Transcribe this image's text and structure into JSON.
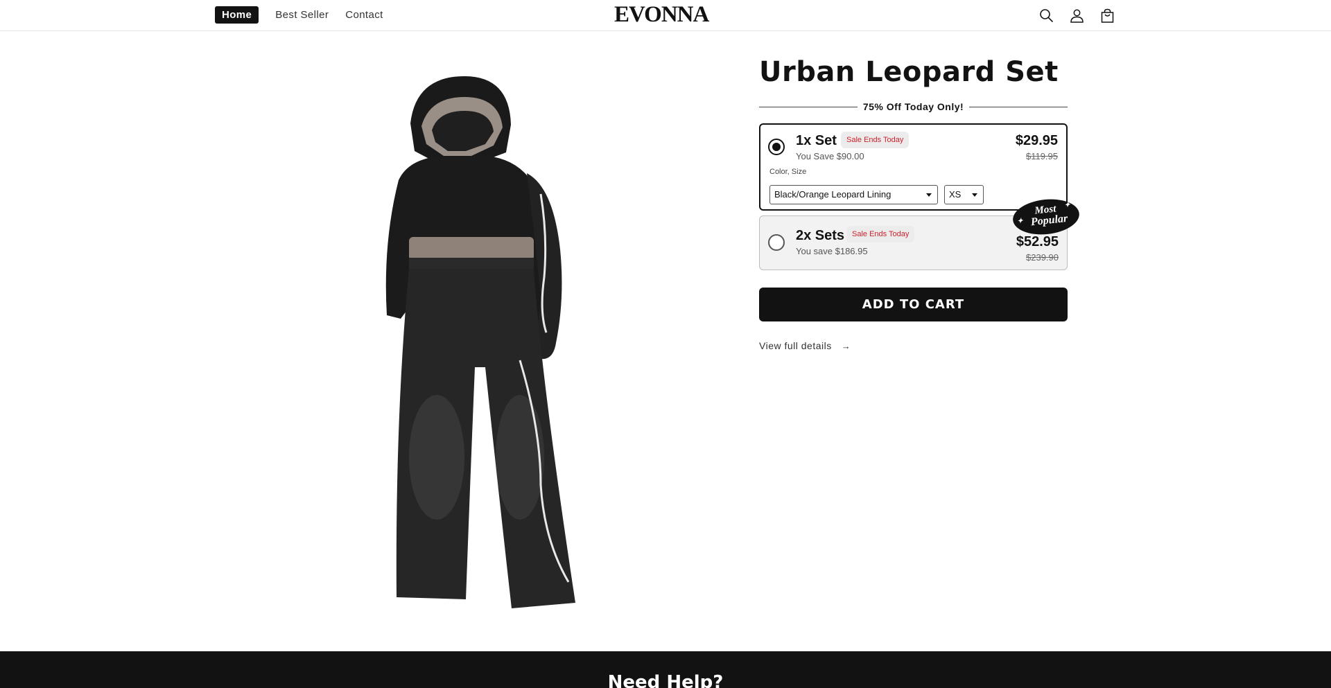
{
  "header": {
    "nav": [
      "Home",
      "Best Seller",
      "Contact"
    ],
    "logo": "EVONNA",
    "icons": [
      "search-icon",
      "account-icon",
      "cart-icon"
    ]
  },
  "product": {
    "title": "Urban Leopard Set",
    "promo": "75% Off Today Only!",
    "image": "hoodie-and-sweatpants-set-photo",
    "options": [
      {
        "name": "1x Set",
        "badge": "Sale Ends Today",
        "savings": "You Save $90.00",
        "price": "$29.95",
        "compare_price": "$119.95",
        "selected": true,
        "variant_label": "Color, Size",
        "color_value": "Black/Orange Leopard Lining",
        "size_value": "XS"
      },
      {
        "name": "2x Sets",
        "badge": "Sale Ends Today",
        "savings": "You save $186.95",
        "price": "$52.95",
        "compare_price": "$239.90",
        "selected": false
      }
    ],
    "popular_badge": {
      "line1": "Most",
      "line2": "Popular"
    },
    "add_to_cart": "ADD TO CART",
    "details_link": "View full details"
  },
  "footer": {
    "title": "Need Help?"
  },
  "colors": {
    "primary": "#121212",
    "sale_red": "#d0202a",
    "option_bg": "#f2f2f2"
  }
}
